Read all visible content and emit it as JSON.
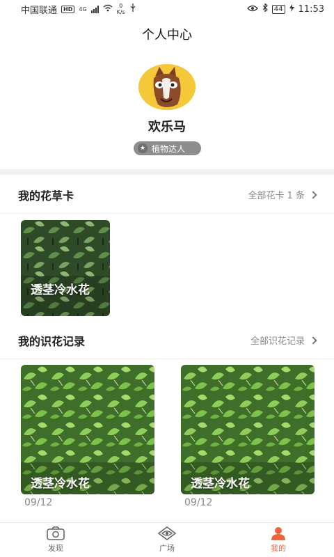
{
  "status_bar": {
    "carrier": "中国联通",
    "hd": "HD",
    "network": "4G",
    "speed_value": "0",
    "speed_unit": "K/s",
    "battery": "44",
    "time": "11:53"
  },
  "header": {
    "title": "个人中心"
  },
  "profile": {
    "username": "欢乐马",
    "badge": "植物达人"
  },
  "flower_cards": {
    "title": "我的花草卡",
    "link": "全部花卡 1 条",
    "items": [
      {
        "name": "透茎冷水花"
      }
    ]
  },
  "records": {
    "title": "我的识花记录",
    "link": "全部识花记录",
    "items": [
      {
        "name": "透茎冷水花",
        "date": "09/12"
      },
      {
        "name": "透茎冷水花",
        "date": "09/12"
      }
    ]
  },
  "tab_bar": {
    "tabs": [
      {
        "label": "发现",
        "icon": "camera-icon"
      },
      {
        "label": "广场",
        "icon": "eye-diamond-icon"
      },
      {
        "label": "我的",
        "icon": "person-icon"
      }
    ],
    "active": "我的"
  },
  "colors": {
    "accent": "#f0643c",
    "badge_bg": "#8d8d8d",
    "avatar_bg": "#f3c93a"
  }
}
